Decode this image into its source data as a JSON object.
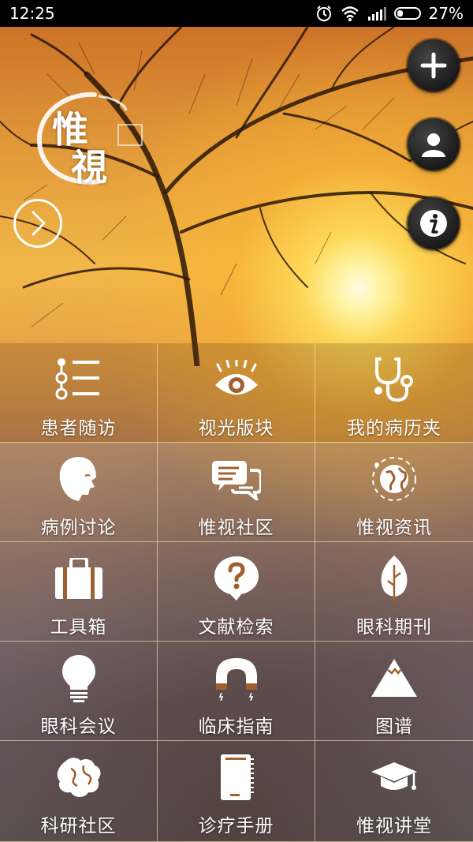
{
  "status_bar": {
    "time": "12:25",
    "battery_percent": 27,
    "battery_label": "27%",
    "icons": [
      "alarm-icon",
      "wifi-icon",
      "signal-icon",
      "battery-icon"
    ]
  },
  "logo": {
    "char1": "惟",
    "char2": "視"
  },
  "actions": {
    "add": "plus-icon",
    "profile": "user-icon",
    "info": "info-icon",
    "next": "chevron-right-icon"
  },
  "menu": [
    {
      "label": "患者随访",
      "icon": "followup-list-icon"
    },
    {
      "label": "视光版块",
      "icon": "eye-icon"
    },
    {
      "label": "我的病历夹",
      "icon": "stethoscope-icon"
    },
    {
      "label": "病例讨论",
      "icon": "head-profile-icon"
    },
    {
      "label": "惟视社区",
      "icon": "chat-bubbles-icon"
    },
    {
      "label": "惟视资讯",
      "icon": "globe-icon"
    },
    {
      "label": "工具箱",
      "icon": "toolbox-icon"
    },
    {
      "label": "文献检索",
      "icon": "question-bubble-icon"
    },
    {
      "label": "眼科期刊",
      "icon": "leaf-icon"
    },
    {
      "label": "眼科会议",
      "icon": "lightbulb-icon"
    },
    {
      "label": "临床指南",
      "icon": "magnet-icon"
    },
    {
      "label": "图谱",
      "icon": "mountain-icon"
    },
    {
      "label": "科研社区",
      "icon": "brain-icon"
    },
    {
      "label": "诊疗手册",
      "icon": "notebook-icon"
    },
    {
      "label": "惟视讲堂",
      "icon": "graduation-cap-icon"
    }
  ],
  "colors": {
    "grid_line": "#f3e2bb",
    "fab_bg": "#1f1f1f"
  }
}
